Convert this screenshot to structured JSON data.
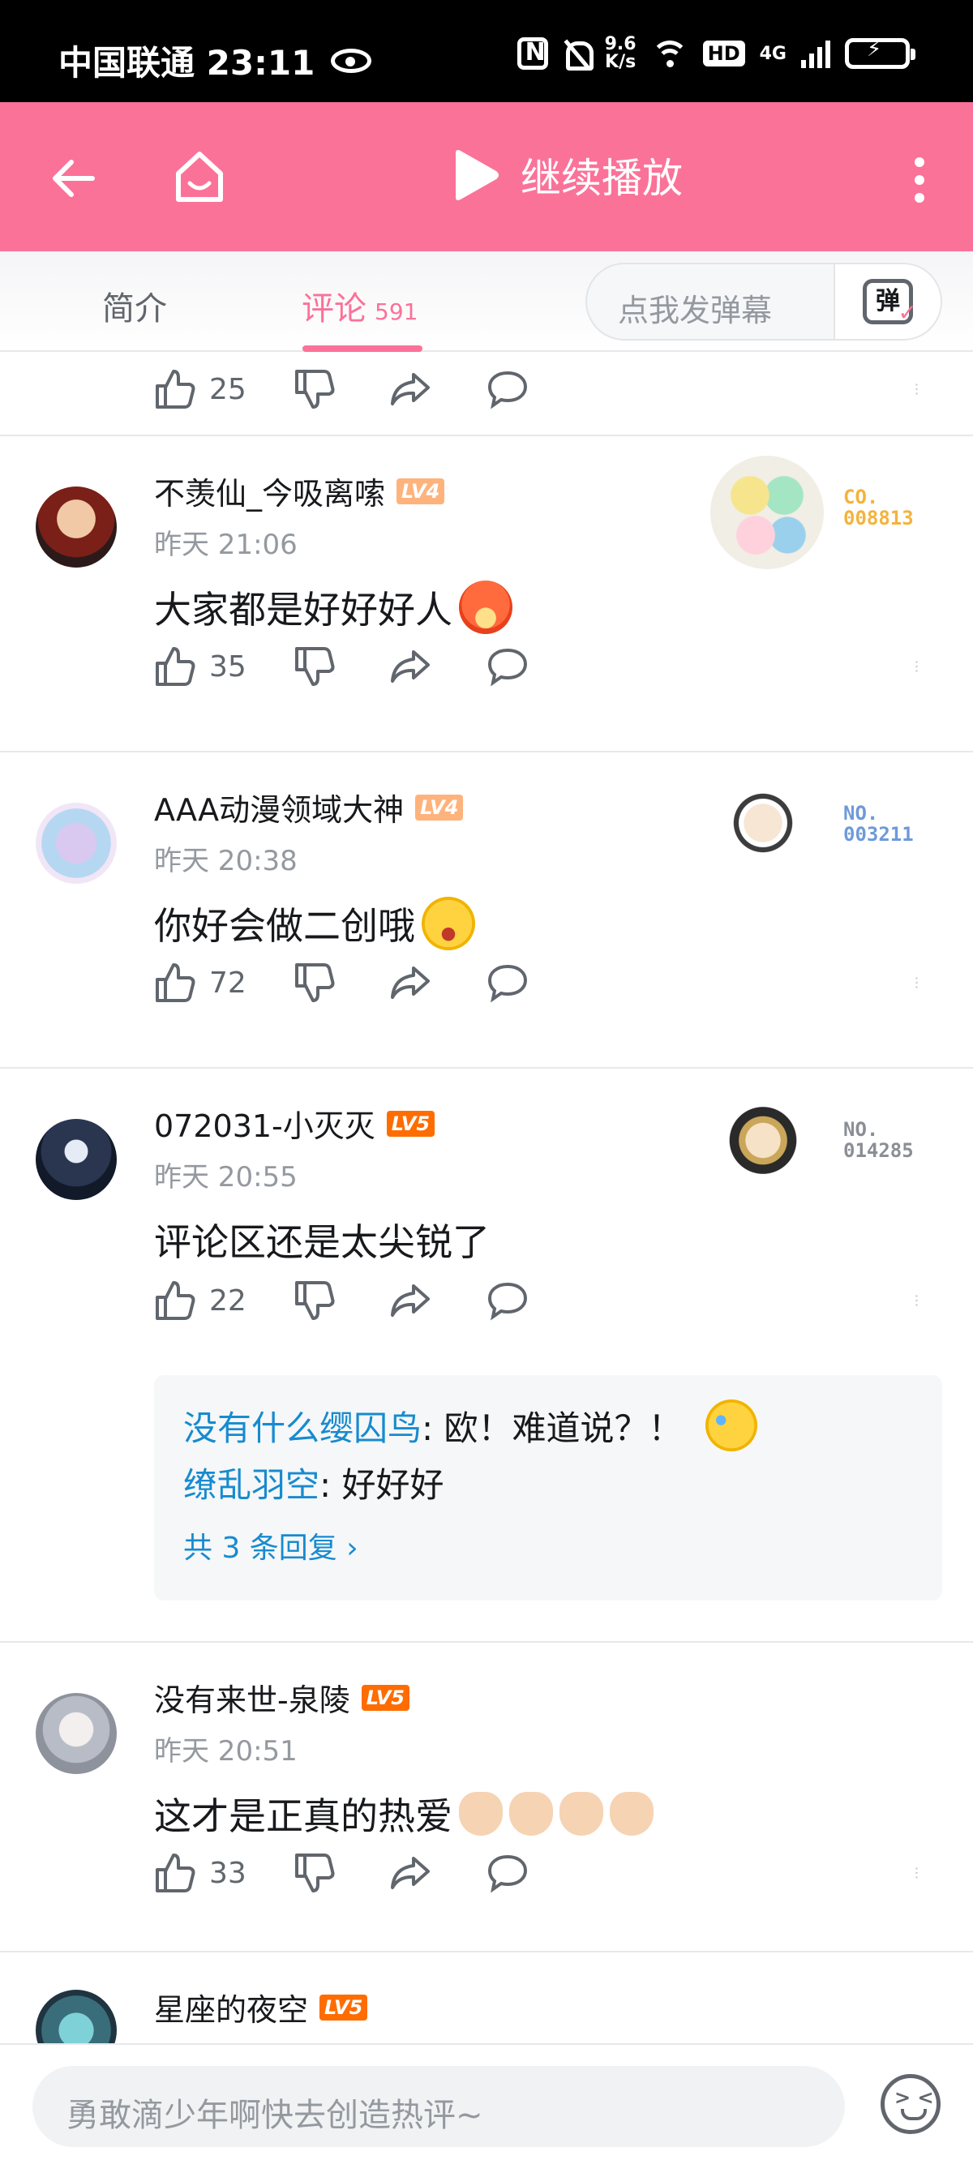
{
  "status_bar": {
    "carrier_time": "中国联通 23:11",
    "net_speed_value": "9.6",
    "net_speed_unit": "K/s",
    "hd": "HD",
    "network": "4G"
  },
  "top_nav": {
    "play_label": "继续播放"
  },
  "tabs": {
    "intro": "简介",
    "comments": "评论",
    "comments_count": "591",
    "danmaku_placeholder": "点我发弹幕",
    "danmaku_icon_text": "弹"
  },
  "colors": {
    "brand": "#fb7299",
    "reply_link": "#178bcf",
    "lv4": "#ffb37c",
    "lv5": "#ff6c00"
  },
  "partial_comment": {
    "likes": "25"
  },
  "comments": [
    {
      "user": "不羡仙_今吸离嗦",
      "level": "LV4",
      "time": "昨天 21:06",
      "text": "大家都是好好好人",
      "likes": "35",
      "fan_no": [
        "CO.",
        "008813"
      ],
      "fan_color": "#f4b33c"
    },
    {
      "user": "AAA动漫领域大神",
      "level": "LV4",
      "time": "昨天 20:38",
      "text": "你好会做二创哦",
      "likes": "72",
      "fan_no": [
        "NO.",
        "003211"
      ],
      "fan_color": "#6e9ad9"
    },
    {
      "user": "072031-小灭灭",
      "level": "LV5",
      "time": "昨天 20:55",
      "text": "评论区还是太尖锐了",
      "likes": "22",
      "fan_no": [
        "NO.",
        "014285"
      ],
      "fan_color": "#8a8f96",
      "replies": [
        {
          "name": "没有什么缨囚鸟",
          "text": ": 欧！难道说？！"
        },
        {
          "name": "缭乱羽空",
          "text": ": 好好好"
        }
      ],
      "replies_more": "共 3 条回复 ›"
    },
    {
      "user": "没有来世-泉陵",
      "level": "LV5",
      "time": "昨天 20:51",
      "text": "这才是正真的热爱",
      "likes": "33"
    },
    {
      "user": "星座的夜空",
      "level": "LV5"
    }
  ],
  "bottom_bar": {
    "placeholder": "勇敢滴少年啊快去创造热评~"
  }
}
